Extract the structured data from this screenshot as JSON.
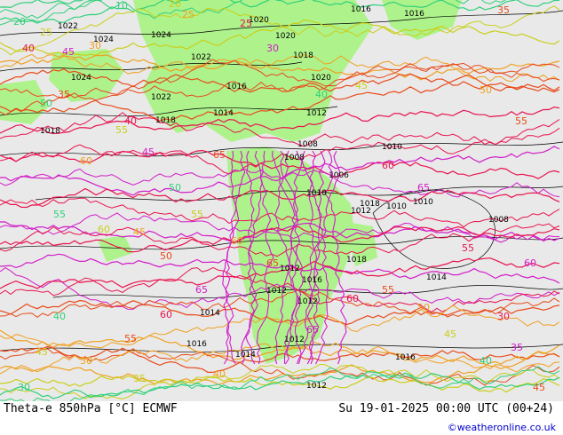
{
  "footer": {
    "product_caption": "Theta-e 850hPa [°C] ECMWF",
    "valid_time": "Su 19-01-2025 00:00 UTC (00+24)",
    "credit": "©weatheronline.co.uk"
  },
  "colors": {
    "land_background": "#e9e9e9",
    "precipitation_area": "#aef28c",
    "isobar_line": "#000000",
    "theta_cold": "#2fd07a",
    "theta_cool": "#c9cf1a",
    "theta_mild": "#f0a020",
    "theta_warm": "#e84a1a",
    "theta_hot": "#e8134f",
    "theta_very_hot": "#d21cc8"
  },
  "map": {
    "isobar_labels": [
      "1016",
      "1016",
      "1020",
      "1022",
      "1024",
      "1020",
      "1024",
      "1022",
      "1018",
      "1016",
      "1020",
      "1024",
      "1018",
      "1022",
      "1018",
      "1014",
      "1012",
      "1008",
      "1010",
      "1008",
      "1006",
      "1012",
      "1010",
      "1012",
      "1008",
      "1010",
      "1012",
      "1016",
      "1014",
      "1012",
      "1016",
      "1010",
      "1012",
      "1014",
      "1012",
      "1014",
      "1016",
      "1018",
      "1018"
    ],
    "theta_labels": [
      "10",
      "20",
      "25",
      "35",
      "40",
      "45",
      "50",
      "55",
      "60",
      "65",
      "25",
      "30",
      "40",
      "45",
      "50",
      "55",
      "60",
      "65",
      "55",
      "60",
      "45",
      "50",
      "55",
      "60",
      "20",
      "25",
      "30",
      "35",
      "40",
      "45",
      "50",
      "55",
      "60",
      "65",
      "30",
      "35",
      "40",
      "45",
      "50",
      "55",
      "60",
      "65",
      "40",
      "45",
      "50",
      "55",
      "60",
      "65",
      "30",
      "35",
      "40",
      "45"
    ]
  }
}
